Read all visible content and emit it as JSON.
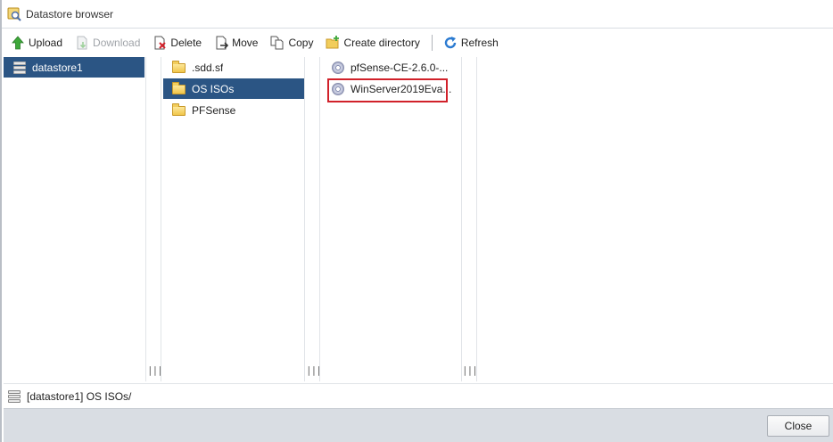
{
  "window": {
    "title": "Datastore browser"
  },
  "toolbar": {
    "upload": "Upload",
    "download": "Download",
    "delete": "Delete",
    "move": "Move",
    "copy": "Copy",
    "create_directory": "Create directory",
    "refresh": "Refresh"
  },
  "columns": {
    "datastores": [
      {
        "label": "datastore1",
        "selected": true,
        "icon": "datastore-icon"
      }
    ],
    "folders": [
      {
        "label": ".sdd.sf",
        "selected": false,
        "icon": "folder-icon"
      },
      {
        "label": "OS ISOs",
        "selected": true,
        "icon": "folder-icon"
      },
      {
        "label": "PFSense",
        "selected": false,
        "icon": "folder-icon"
      }
    ],
    "files": [
      {
        "label": "pfSense-CE-2.6.0-...",
        "selected": false,
        "icon": "disc-image-icon"
      },
      {
        "label": "WinServer2019Eva...",
        "selected": false,
        "highlighted": true,
        "icon": "disc-image-icon"
      }
    ],
    "resize_grip": "|||"
  },
  "status": {
    "path": "[datastore1] OS ISOs/"
  },
  "footer": {
    "close": "Close"
  },
  "colors": {
    "selection": "#2b5584",
    "highlight_border": "#d1212a",
    "footer_bg": "#d9dde3"
  }
}
